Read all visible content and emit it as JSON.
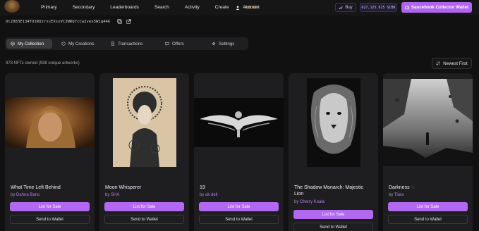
{
  "nav": {
    "items": [
      "Primary",
      "Secondary",
      "Leaderboards",
      "Search",
      "Activity",
      "Create",
      "Admin"
    ],
    "account_label": "Account",
    "buy_label": "Buy",
    "balance": "627,125.615 SCBK",
    "wallet_button": "Saucebook Collector Wallet"
  },
  "profile": {
    "address": "Ot2883E134TU1RUJrxsEXsxVC2WRQ7cCw2ven5W1g446"
  },
  "tabs": [
    {
      "label": "My Collection",
      "icon": "cube-icon",
      "active": true
    },
    {
      "label": "My Creations",
      "icon": "palette-icon",
      "active": false
    },
    {
      "label": "Transactions",
      "icon": "receipt-icon",
      "active": false
    },
    {
      "label": "Offers",
      "icon": "chat-icon",
      "active": false
    },
    {
      "label": "Settings",
      "icon": "gear-icon",
      "active": false
    }
  ],
  "collection": {
    "owned_text": "973 NFTs owned (938 unique artworks)",
    "sort_label": "Newest First"
  },
  "cards": [
    {
      "title": "What Time Left Behind",
      "by": "by ",
      "author": "Dahna Bano",
      "list": "List for Sale",
      "send": "Send to Wallet",
      "extra": "",
      "heart": ""
    },
    {
      "title": "Moon Whisperer",
      "by": "by ",
      "author": "SHA",
      "list": "List for Sale",
      "send": "Send to Wallet",
      "extra": "",
      "heart": ""
    },
    {
      "title": "19",
      "by": "by ",
      "author": "ak dell",
      "list": "List for Sale",
      "send": "Send to Wallet",
      "extra": "",
      "heart": ""
    },
    {
      "title": "The Shadow Monarch: Majestic Lion",
      "by": "by ",
      "author": "Cherry Koala",
      "list": "List for Sale",
      "send": "Send to Wallet",
      "extra": "",
      "heart": ""
    },
    {
      "title": "Darkness",
      "by": "by ",
      "author": "Tiara",
      "list": "List for Sale",
      "send": "Send to Wallet",
      "extra": "",
      "heart": "♡"
    }
  ],
  "colors": {
    "accent": "#b268f0",
    "admin": "#f0b04a"
  }
}
